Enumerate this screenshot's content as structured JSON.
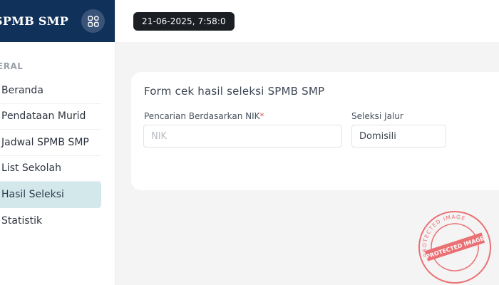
{
  "app": {
    "title": "SPMB SMP"
  },
  "header": {
    "timestamp": "21-06-2025, 7:58:0"
  },
  "sidebar": {
    "section_label": "ERAL",
    "items": [
      {
        "label": "Beranda"
      },
      {
        "label": "Pendataan Murid"
      },
      {
        "label": "Jadwal SPMB SMP"
      },
      {
        "label": "List Sekolah"
      },
      {
        "label": "Hasil Seleksi",
        "active": true
      },
      {
        "label": "Statistik"
      }
    ]
  },
  "form": {
    "title": "Form cek hasil seleksi SPMB SMP",
    "nik_label": "Pencarian Berdasarkan NIK",
    "nik_required": "*",
    "nik_placeholder": "NIK",
    "nik_value": "",
    "jalur_label": "Seleksi Jalur",
    "jalur_selected": "Domisili"
  },
  "watermark": {
    "outer_text": "PROTECTED IMAGE",
    "center_text": "PROTECTED IMAGE",
    "color": "#e8454a"
  },
  "colors": {
    "brand": "#10315a",
    "active_item": "#d3e8ea",
    "timestamp_bg": "#1b1f24"
  }
}
